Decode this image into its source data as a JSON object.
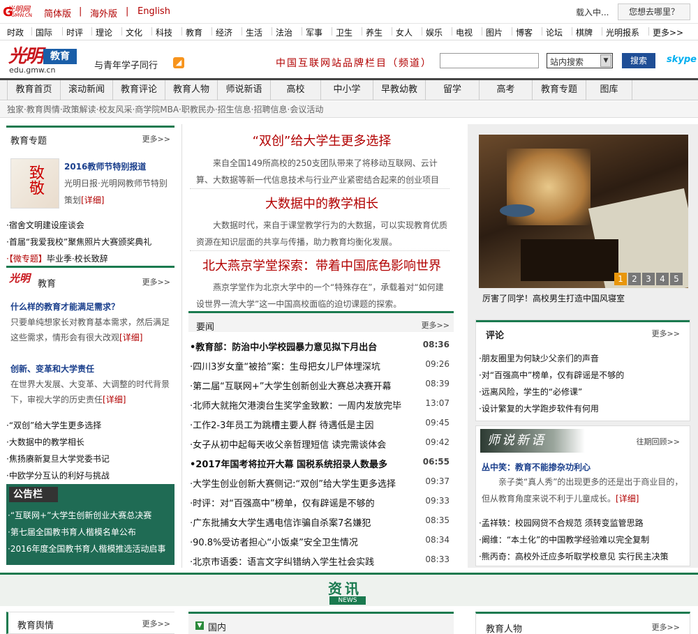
{
  "topbar": {
    "logo_text": "光明网",
    "logo_sub": "GMW.CN",
    "lang_links": [
      "简体版",
      "海外版",
      "English"
    ],
    "separators": [
      "|",
      "|"
    ],
    "loading": "载入中...",
    "where_btn": "您想去哪里？"
  },
  "channel_nav": [
    "时政",
    "国际",
    "时评",
    "理论",
    "文化",
    "科技",
    "教育",
    "经济",
    "生活",
    "法治",
    "军事",
    "卫生",
    "养生",
    "女人",
    "娱乐",
    "电视",
    "图片",
    "博客",
    "论坛",
    "棋牌",
    "光明报系",
    "更多>>"
  ],
  "header": {
    "logo_chinese": "光明",
    "logo_badge": "教育",
    "logo_domain": "edu.gmw.cn",
    "slogan": "与青年学子同行",
    "brand_text": "中国互联网站品牌栏目（频道）",
    "search_placeholder": "",
    "search_scope": "站内搜索",
    "search_button": "搜索",
    "skype": "skype"
  },
  "main_nav": [
    "教育首页",
    "滚动新闻",
    "教育评论",
    "教育人物",
    "师说新语",
    "高校",
    "中小学",
    "早教幼教",
    "留学",
    "高考",
    "教育专题",
    "图库"
  ],
  "sub_nav": "独家·教育舆情·政策解读·校友风采·商学院MBA·职教民办·招生信息·招聘信息·会议活动",
  "left": {
    "special": {
      "title": "教育专题",
      "more": "更多>>",
      "feature_title": "2016教师节特别报道",
      "feature_desc": "光明日报·光明网教师节特别策划",
      "feature_detail": "[详细]",
      "thumb_text": "致敬",
      "links": [
        "·宿舍文明建设座谈会",
        "·首届“我爱我校”聚焦照片大赛颁奖典礼"
      ],
      "promo_tag": "·【微专题】",
      "promo_text": "毕业季·校长致辞"
    },
    "edu": {
      "brand": "光明",
      "title": "教育",
      "more": "更多>>",
      "q1": "什么样的教育才能满足需求？",
      "q1_desc": "只要单纯想家长对教育基本需求，然后满足这些需求，情形会有很大改观",
      "q1_detail": "[详细]",
      "q2": "创新、变革和大学责任",
      "q2_desc": "在世界大发展、大变革、大调整的时代背景下，审视大学的历史责任",
      "q2_detail": "[详细]",
      "links": [
        "·“双创”给大学生更多选择",
        "·大数据中的教学相长",
        "·焦扬赓新复旦大学党委书记",
        "·中欧学分互认的利好与挑战"
      ]
    },
    "notice": {
      "title": "公告栏",
      "links": [
        "·“互联网+”大学生创新创业大赛总决赛",
        "·第七届全国教书育人楷模名单公布",
        "·2016年度全国教书育人楷模推选活动启事"
      ]
    }
  },
  "center": {
    "headlines": [
      {
        "title": "“双创”给大学生更多选择",
        "desc": "来自全国149所高校的250支团队带来了将移动互联网、云计算、大数据等新一代信息技术与行业产业紧密结合起来的创业项目"
      },
      {
        "title": "大数据中的教学相长",
        "desc": "大数据时代，来自于课堂教学行为的大数据，可以实现教育优质资源在知识层面的共享与传播，助力教育均衡化发展。"
      },
      {
        "title": "北大燕京学堂探索：带着中国底色影响世界",
        "desc": "燕京学堂作为北京大学中的一个“特殊存在”，承载着对“如何建设世界一流大学”这一中国高校面临的迫切课题的探索。"
      }
    ],
    "news_title": "要闻",
    "news_more": "更多>>",
    "news": [
      {
        "title": "•教育部：防治中小学校园暴力意见拟下月出台",
        "time": "08:36",
        "bold": true
      },
      {
        "title": "·四川3岁女童“被拾”案：生母把女儿尸体埋深坑",
        "time": "09:26",
        "bold": false
      },
      {
        "title": "·第二届“互联网+”大学生创新创业大赛总决赛开幕",
        "time": "08:39",
        "bold": false
      },
      {
        "title": "·北师大就拖欠港澳台生奖学金致歉：一周内发放完毕",
        "time": "13:07",
        "bold": false
      },
      {
        "title": "·工作2-3年员工为跳槽主要人群 待遇低是主因",
        "time": "09:45",
        "bold": false
      },
      {
        "title": "·女子从初中起每天收父亲哲理短信 读完需谈体会",
        "time": "09:42",
        "bold": false
      },
      {
        "title": "•2017年国考将拉开大幕 国税系统招录人数最多",
        "time": "06:55",
        "bold": true
      },
      {
        "title": "·大学生创业创新大赛侧记:“双创”给大学生更多选择",
        "time": "09:37",
        "bold": false
      },
      {
        "title": "·时评：对“百强高中”榜单，仅有辟谣是不够的",
        "time": "09:33",
        "bold": false
      },
      {
        "title": "·广东批捕女大学生遇电信诈骗自杀案7名嫌犯",
        "time": "08:35",
        "bold": false
      },
      {
        "title": "·90.8%受访者担心“小饭桌”安全卫生情况",
        "time": "08:34",
        "bold": false
      },
      {
        "title": "·北京市语委：语言文字纠错纳入学生社会实践",
        "time": "08:33",
        "bold": false
      }
    ]
  },
  "right": {
    "slideshow": {
      "caption": "厉害了同学！高校男生打造中国风寝室",
      "pages": [
        "1",
        "2",
        "3",
        "4",
        "5"
      ],
      "active": "1"
    },
    "comment": {
      "title": "评论",
      "more": "更多>>",
      "links": [
        "·朋友圈里为何缺少父亲们的声音",
        "·对“百强高中”榜单，仅有辟谣是不够的",
        "·远离风险，学生的“必修课”",
        "·设计繁复的大学跑步软件有何用"
      ]
    },
    "teacher": {
      "banner": "师说新语",
      "past": "往期回顾>>",
      "headline": "丛中笑：教育不能掺杂功利心",
      "desc": "亲子类“真人秀”的出现更多的还是出于商业目的，但从教育角度来说不利于儿童成长。",
      "detail": "[详细]",
      "links": [
        "·孟祥轶：校园网贷不合规范 须转变监管思路",
        "·阚维：“本土化”的中国教学经验难以完全复制",
        "·熊丙奇：高校外迁应多听取学校意见 实行民主决策"
      ]
    }
  },
  "bottom": {
    "banner_cn": "资讯",
    "banner_en": "NEWS",
    "col1_title": "教育舆情",
    "col1_more": "更多>>",
    "col2_title": "国内",
    "col3_title": "教育人物",
    "col3_more": "更多>>"
  },
  "colors": {
    "brand_red": "#b20000",
    "green": "#1a7a4f",
    "nav_dark": "#444444",
    "search_blue": "#1f4e96"
  }
}
